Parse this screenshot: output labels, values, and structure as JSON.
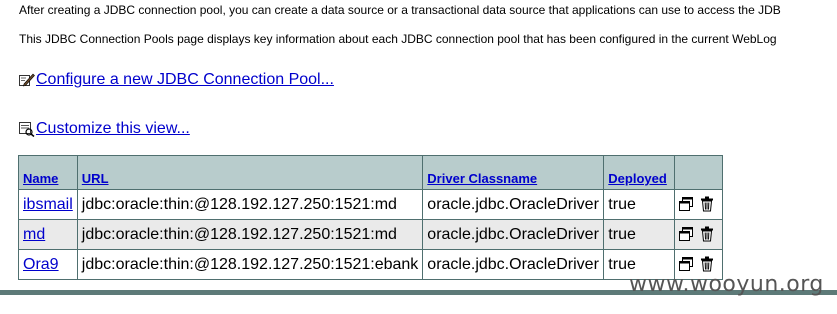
{
  "intro": {
    "line1": "After creating a JDBC connection pool, you can create a data source or a transactional data source that applications can use to access the JDB",
    "line2": "This JDBC Connection Pools page displays key information about each JDBC connection pool that has been configured in the current WebLog"
  },
  "links": {
    "configure": "Configure a new JDBC Connection Pool...",
    "configure_icon": "edit-pencil-icon",
    "customize": "Customize this view...",
    "customize_icon": "customize-view-icon"
  },
  "table": {
    "columns": [
      "Name",
      "URL",
      "Driver Classname",
      "Deployed",
      ""
    ],
    "rows": [
      {
        "name": "ibsmail",
        "url": "jdbc:oracle:thin:@128.192.127.250:1521:md",
        "driver": "oracle.jdbc.OracleDriver",
        "deployed": "true"
      },
      {
        "name": "md",
        "url": "jdbc:oracle:thin:@128.192.127.250:1521:md",
        "driver": "oracle.jdbc.OracleDriver",
        "deployed": "true"
      },
      {
        "name": "Ora9",
        "url": "jdbc:oracle:thin:@128.192.127.250:1521:ebank",
        "driver": "oracle.jdbc.OracleDriver",
        "deployed": "true"
      }
    ],
    "row_actions": [
      "clone-icon",
      "delete-trash-icon"
    ]
  },
  "colors": {
    "header_bg": "#b8cccc",
    "border": "#4f6f6f",
    "link": "#0000cc",
    "bar": "#5d7a78"
  },
  "watermark": "www.wooyun.org"
}
